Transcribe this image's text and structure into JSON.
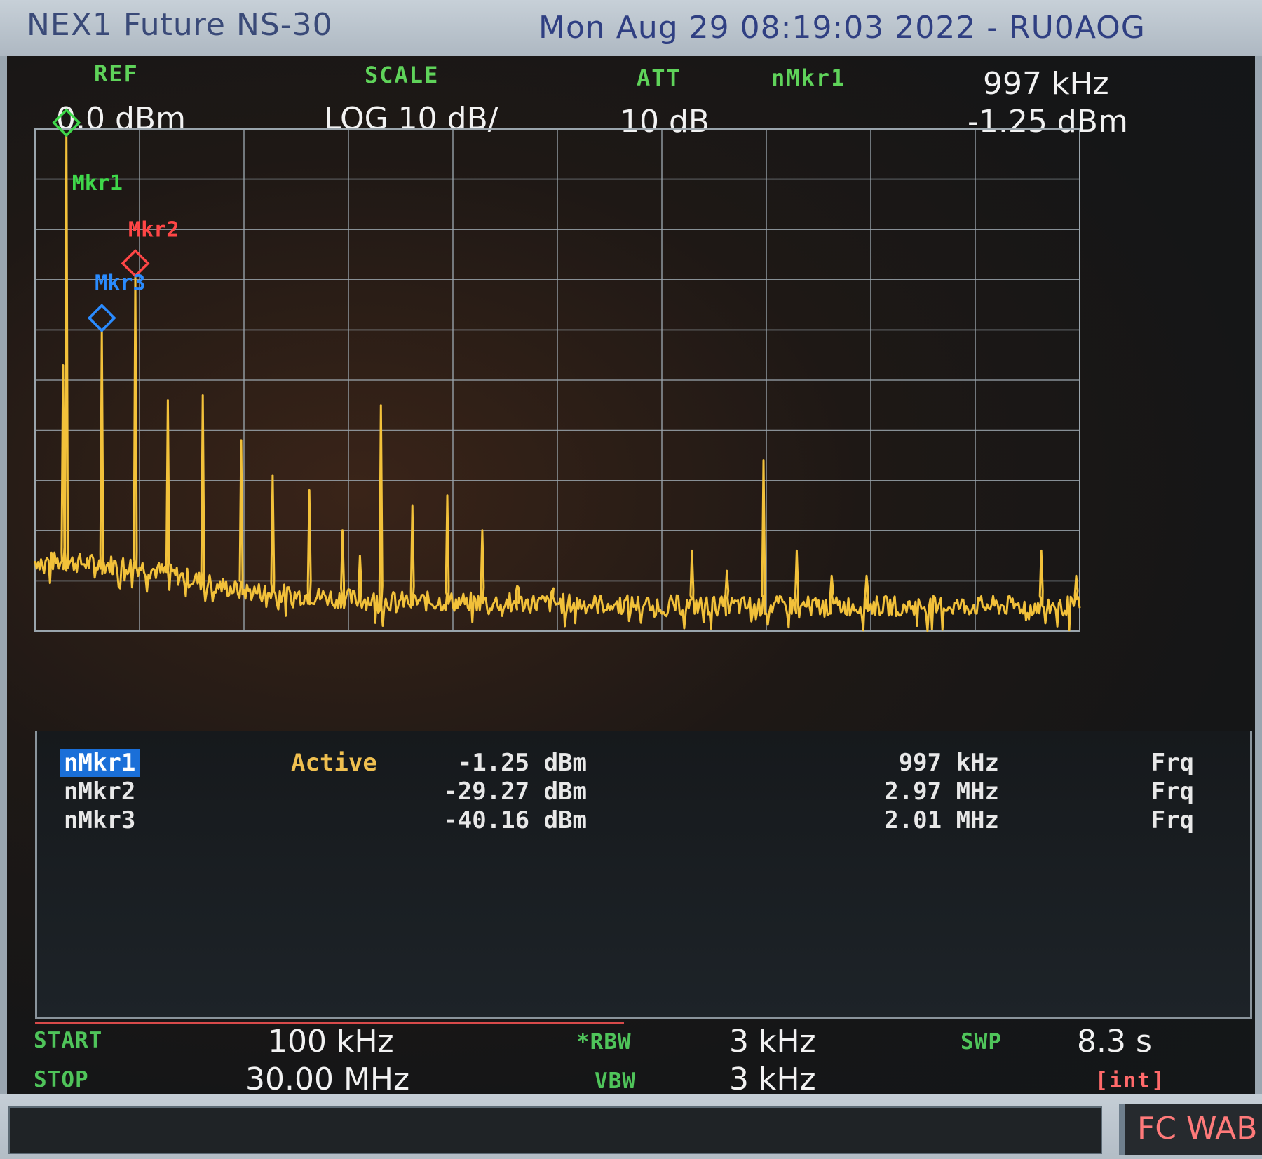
{
  "top_bar": {
    "model": "NEX1 Future NS-30",
    "title": "Mon Aug 29 08:19:03 2022 - RU0AOG"
  },
  "header": {
    "ref_label": "REF",
    "ref_value": "0.0 dBm",
    "scale_label": "SCALE",
    "scale_value": "LOG 10 dB/",
    "att_label": "ATT",
    "att_value": "10 dB",
    "mkr_label": "nMkr1",
    "mkr_freq": "997 kHz",
    "mkr_amp": "-1.25 dBm"
  },
  "graph_markers": [
    {
      "label": "Mkr1",
      "color": "#3fd84a"
    },
    {
      "label": "Mkr2",
      "color": "#ff4646"
    },
    {
      "label": "Mkr3",
      "color": "#2a8bff"
    }
  ],
  "marker_table": [
    {
      "name": "nMkr1",
      "state": "Active",
      "amp": "-1.25 dBm",
      "freq": "997 kHz",
      "mode": "Frq"
    },
    {
      "name": "nMkr2",
      "state": "",
      "amp": "-29.27 dBm",
      "freq": "2.97 MHz",
      "mode": "Frq"
    },
    {
      "name": "nMkr3",
      "state": "",
      "amp": "-40.16 dBm",
      "freq": "2.01 MHz",
      "mode": "Frq"
    }
  ],
  "footer": {
    "start_label": "START",
    "start_value": "100 kHz",
    "stop_label": "STOP",
    "stop_value": "30.00 MHz",
    "rbw_label": "*RBW",
    "rbw_value": "3 kHz",
    "vbw_label": "VBW",
    "vbw_value": "3 kHz",
    "swp_label": "SWP",
    "swp_value": "8.3 s",
    "swp_mode": "[int]"
  },
  "bottom_badge": "FC WAB",
  "colors": {
    "trace": "#f2c13a",
    "grid": "#9aa5ad",
    "label_green": "#5fd35a",
    "highlight": "#1a6fd8",
    "warning": "#ff6a6a"
  },
  "chart_data": {
    "type": "line",
    "x_unit": "MHz",
    "y_unit": "dBm",
    "xlim": [
      0.1,
      30.0
    ],
    "ylim": [
      -100,
      0
    ],
    "grid": true,
    "noise_floor": [
      {
        "x": 0.1,
        "y": -86
      },
      {
        "x": 3.0,
        "y": -87
      },
      {
        "x": 6.0,
        "y": -92
      },
      {
        "x": 10.0,
        "y": -94
      },
      {
        "x": 20.0,
        "y": -95
      },
      {
        "x": 30.0,
        "y": -95
      }
    ],
    "peaks": [
      {
        "x": 0.9,
        "y": -47
      },
      {
        "x": 0.997,
        "y": -1.25
      },
      {
        "x": 2.01,
        "y": -40.16
      },
      {
        "x": 2.97,
        "y": -29.27
      },
      {
        "x": 3.9,
        "y": -54
      },
      {
        "x": 4.9,
        "y": -53
      },
      {
        "x": 6.0,
        "y": -62
      },
      {
        "x": 6.9,
        "y": -69
      },
      {
        "x": 7.95,
        "y": -72
      },
      {
        "x": 8.9,
        "y": -80
      },
      {
        "x": 9.4,
        "y": -85
      },
      {
        "x": 10.0,
        "y": -55
      },
      {
        "x": 10.9,
        "y": -75
      },
      {
        "x": 11.9,
        "y": -73
      },
      {
        "x": 12.9,
        "y": -80
      },
      {
        "x": 13.9,
        "y": -91
      },
      {
        "x": 14.9,
        "y": -92
      },
      {
        "x": 18.9,
        "y": -84
      },
      {
        "x": 19.9,
        "y": -88
      },
      {
        "x": 20.95,
        "y": -66
      },
      {
        "x": 21.9,
        "y": -84
      },
      {
        "x": 22.9,
        "y": -89
      },
      {
        "x": 23.9,
        "y": -89
      },
      {
        "x": 28.9,
        "y": -84
      },
      {
        "x": 29.9,
        "y": -89
      }
    ],
    "markers": [
      {
        "name": "Mkr1",
        "x": 0.997,
        "y": -1.25
      },
      {
        "name": "Mkr2",
        "x": 2.97,
        "y": -29.27
      },
      {
        "name": "Mkr3",
        "x": 2.01,
        "y": -40.16
      }
    ]
  }
}
